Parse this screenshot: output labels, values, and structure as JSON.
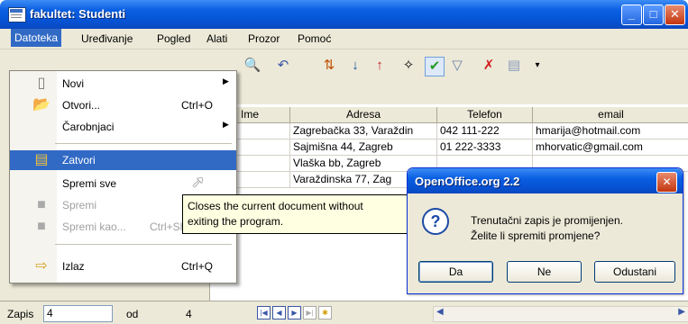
{
  "window": {
    "title": "fakultet: Studenti"
  },
  "menubar": [
    "Datoteka",
    "Uređivanje",
    "Pogled",
    "Alati",
    "Prozor",
    "Pomoć"
  ],
  "file_menu": [
    {
      "label": "Novi",
      "shortcut": "",
      "submenu": true,
      "icon": "new-doc-icon"
    },
    {
      "label": "Otvori...",
      "shortcut": "Ctrl+O",
      "submenu": false,
      "icon": "open-folder-icon"
    },
    {
      "label": "Čarobnjaci",
      "shortcut": "",
      "submenu": true,
      "icon": ""
    },
    {
      "label": "Zatvori",
      "shortcut": "",
      "submenu": false,
      "icon": "close-doc-icon",
      "highlighted": true
    },
    {
      "label": "Spremi sve",
      "shortcut": "",
      "submenu": false,
      "icon": ""
    },
    {
      "label": "Spremi",
      "shortcut": "",
      "submenu": false,
      "icon": "save-icon",
      "disabled": true
    },
    {
      "label": "Spremi kao...",
      "shortcut": "Ctrl+Shift+S",
      "submenu": false,
      "icon": "save-as-icon",
      "disabled": true
    },
    {
      "label": "Izlaz",
      "shortcut": "Ctrl+Q",
      "submenu": false,
      "icon": "exit-icon"
    }
  ],
  "tooltip": {
    "line1": "Closes the current document without",
    "line2": "exiting the program."
  },
  "table": {
    "columns": [
      "Ime",
      "Adresa",
      "Telefon",
      "email"
    ],
    "rows": [
      [
        "ja",
        "Zagrebačka 33, Varaždin",
        "042 111-222",
        "hmarija@hotmail.com"
      ],
      [
        "o",
        "Sajmišna 44, Zagreb",
        "01 222-3333",
        "mhorvatic@gmail.com"
      ],
      [
        "ja",
        "Vlaška bb, Zagreb",
        "",
        ""
      ],
      [
        "",
        "Varaždinska 77, Zag",
        "",
        ""
      ]
    ]
  },
  "statusbar": {
    "record_label": "Zapis",
    "record_value": "4",
    "of_label": "od",
    "total": "4"
  },
  "dialog": {
    "title": "OpenOffice.org 2.2",
    "message_line1": "Trenutačni zapis je promijenjen.",
    "message_line2": "Želite li spremiti promjene?",
    "buttons": [
      "Da",
      "Ne",
      "Odustani"
    ]
  }
}
